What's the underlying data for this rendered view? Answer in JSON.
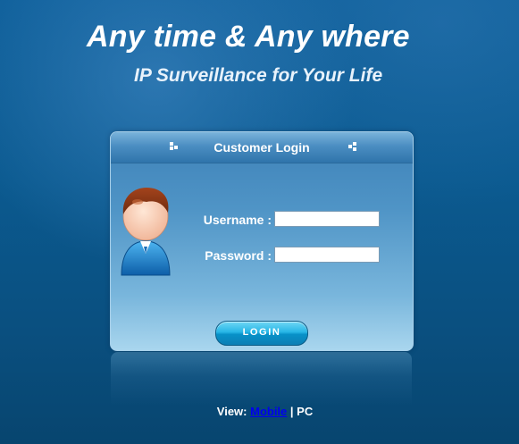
{
  "header": {
    "headline": "Any time & Any where",
    "subheadline": "IP Surveillance for Your Life"
  },
  "login_panel": {
    "title": "Customer Login",
    "username_label": "Username :",
    "password_label": "Password :",
    "username_value": "",
    "password_value": "",
    "login_button": "LOGIN"
  },
  "view_switch": {
    "prefix": "View:",
    "mobile_link": "Mobile",
    "separator": "|",
    "pc_label": "PC"
  },
  "icons": {
    "avatar": "user-avatar-icon",
    "header_left": "pixel-decoration-icon",
    "header_right": "pixel-decoration-icon"
  },
  "colors": {
    "background": "#0b5a90",
    "panel": "#4f94c6",
    "button": "#27b6e6",
    "link": "#0000ee",
    "text": "#ffffff"
  }
}
